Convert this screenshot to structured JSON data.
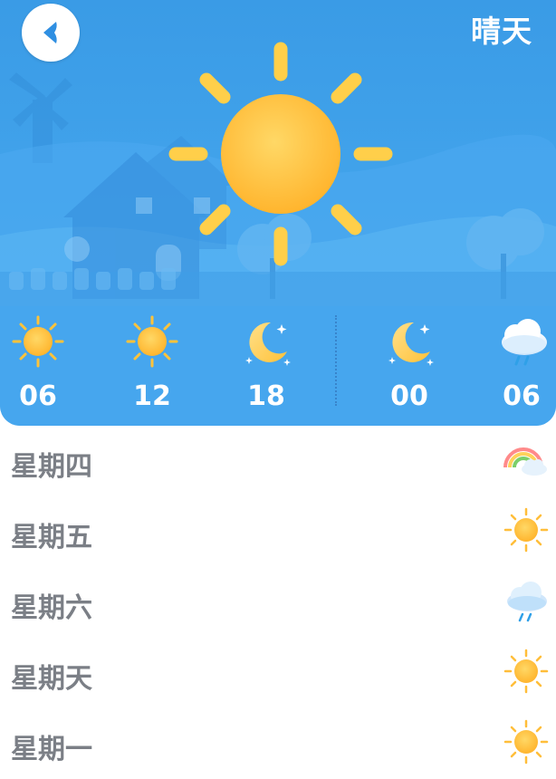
{
  "header": {
    "back_icon": "back-arrow-icon",
    "condition": "晴天"
  },
  "current": {
    "icon": "sun-icon"
  },
  "hourly": [
    {
      "time": "06",
      "icon": "sun-icon"
    },
    {
      "time": "12",
      "icon": "sun-icon"
    },
    {
      "time": "18",
      "icon": "moon-icon"
    },
    {
      "time": "00",
      "icon": "moon-icon"
    },
    {
      "time": "06",
      "icon": "rain-cloud-icon"
    }
  ],
  "daily": [
    {
      "day": "星期四",
      "icon": "rainbow-icon"
    },
    {
      "day": "星期五",
      "icon": "sun-icon"
    },
    {
      "day": "星期六",
      "icon": "rain-cloud-icon"
    },
    {
      "day": "星期天",
      "icon": "sun-icon"
    },
    {
      "day": "星期一",
      "icon": "sun-icon"
    }
  ],
  "colors": {
    "sky": "#3a9be6",
    "sun": "#ffc83d",
    "label": "#7b7f86"
  }
}
